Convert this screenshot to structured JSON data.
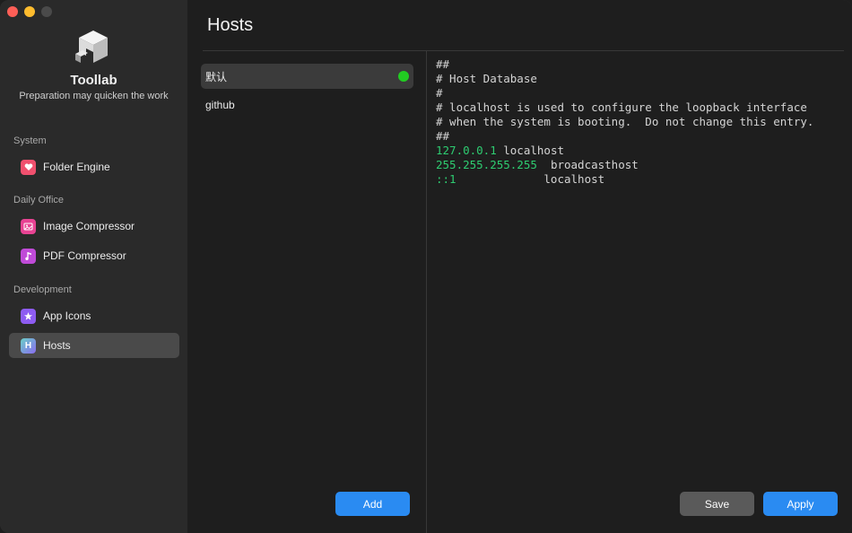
{
  "window": {
    "traffic_lights": [
      "close",
      "minimize",
      "maximize"
    ]
  },
  "sidebar": {
    "app_name": "Toollab",
    "tagline": "Preparation may quicken the work",
    "sections": [
      {
        "label": "System",
        "items": [
          {
            "label": "Folder Engine",
            "icon": "heart-icon",
            "color": "#f0506e"
          }
        ]
      },
      {
        "label": "Daily Office",
        "items": [
          {
            "label": "Image Compressor",
            "icon": "image-icon",
            "color": "#e84393"
          },
          {
            "label": "PDF Compressor",
            "icon": "music-note-icon",
            "color": "#c04bd8"
          }
        ]
      },
      {
        "label": "Development",
        "items": [
          {
            "label": "App Icons",
            "icon": "star-icon",
            "color": "#8e5cf2"
          },
          {
            "label": "Hosts",
            "icon": "h-icon",
            "icon_text": "H",
            "color": "#6a9cf0",
            "active": true
          }
        ]
      }
    ]
  },
  "main": {
    "title": "Hosts",
    "hosts": [
      {
        "name": "默认",
        "selected": true,
        "active": true,
        "status_color": "#22cc22"
      },
      {
        "name": "github",
        "selected": false
      }
    ],
    "add_label": "Add",
    "save_label": "Save",
    "apply_label": "Apply",
    "editor_lines": [
      {
        "comment": "##"
      },
      {
        "comment": "# Host Database"
      },
      {
        "comment": "#"
      },
      {
        "comment": "# localhost is used to configure the loopback interface"
      },
      {
        "comment": "# when the system is booting.  Do not change this entry."
      },
      {
        "comment": "##"
      },
      {
        "ip": "127.0.0.1",
        "host": " localhost"
      },
      {
        "ip": "255.255.255.255",
        "host": "  broadcasthost"
      },
      {
        "ip": "::1",
        "host": "             localhost"
      }
    ]
  }
}
